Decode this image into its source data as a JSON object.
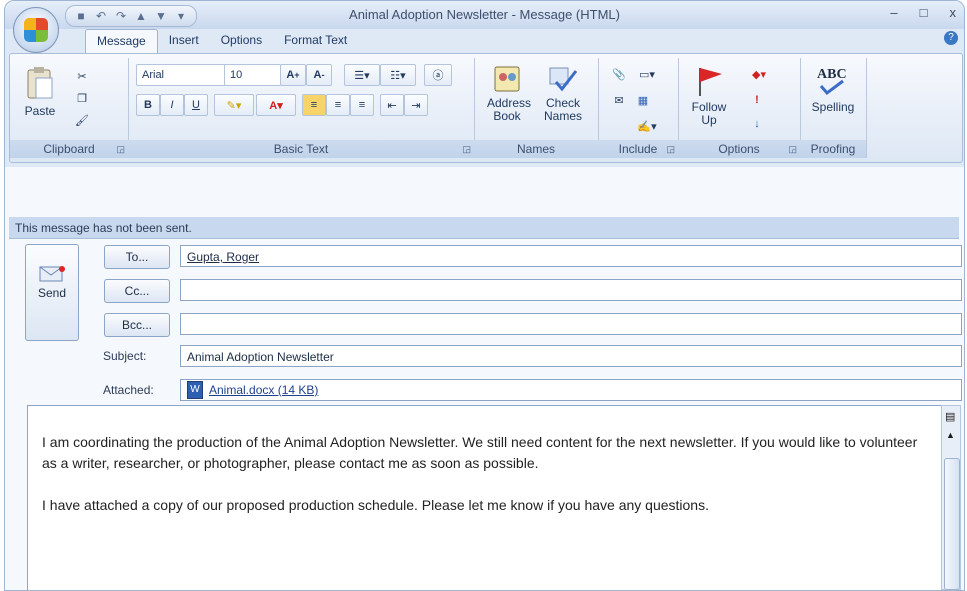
{
  "window": {
    "title": "Animal Adoption Newsletter - Message (HTML)"
  },
  "qat": {
    "icons": [
      "save-icon",
      "undo-icon",
      "redo-icon",
      "previous-item-icon",
      "next-item-icon",
      "customize-icon"
    ]
  },
  "controls": {
    "minimize": "–",
    "maximize": "□",
    "close": "x"
  },
  "tabs": [
    "Message",
    "Insert",
    "Options",
    "Format Text"
  ],
  "ribbon": {
    "clipboard": {
      "label": "Clipboard",
      "paste": "Paste"
    },
    "basic_text": {
      "label": "Basic Text",
      "font": "Arial",
      "size": "10"
    },
    "names": {
      "label": "Names",
      "address_book": "Address Book",
      "check_names": "Check Names"
    },
    "include": {
      "label": "Include"
    },
    "options": {
      "label": "Options",
      "follow_up": "Follow Up"
    },
    "proofing": {
      "label": "Proofing",
      "spelling": "Spelling"
    }
  },
  "info_bar": "This message has not been sent.",
  "compose": {
    "send_label": "Send",
    "to_label": "To...",
    "cc_label": "Cc...",
    "bcc_label": "Bcc...",
    "to_value": "Gupta, Roger",
    "cc_value": "",
    "bcc_value": "",
    "subject_label": "Subject:",
    "subject_value": "Animal Adoption Newsletter",
    "attached_label": "Attached:",
    "attachment": "Animal.docx (14 KB)",
    "body_p1": "I am coordinating the production of the Animal Adoption Newsletter. We still need content for the next newsletter. If you would like to volunteer as a writer, researcher, or photographer, please contact me as soon as possible.",
    "body_p2": "I have attached a copy of our proposed production schedule. Please let me know if you have any questions."
  },
  "colors": {
    "accent": "#c8d8ee",
    "ribbon_bg": "#dde7f4",
    "link": "#1f3f8c"
  }
}
